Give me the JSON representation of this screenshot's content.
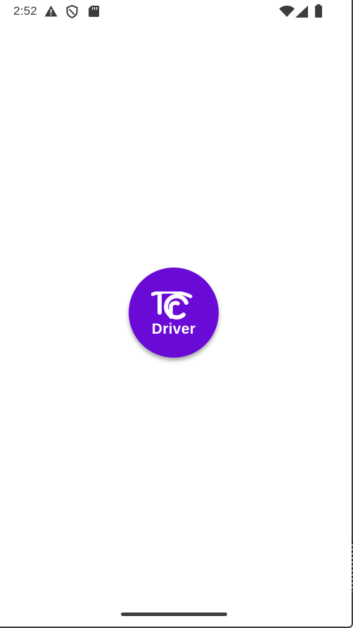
{
  "status_bar": {
    "time": "2:52",
    "left_icons": [
      "warning-icon",
      "vpn-shield-icon",
      "sd-card-icon"
    ],
    "right_icons": [
      "wifi-icon",
      "cellular-signal-icon",
      "battery-icon"
    ]
  },
  "splash": {
    "logo_text": "Driver",
    "logo_color": "#6a0ad6"
  },
  "navigation": {
    "gesture_bar": "home-indicator"
  }
}
